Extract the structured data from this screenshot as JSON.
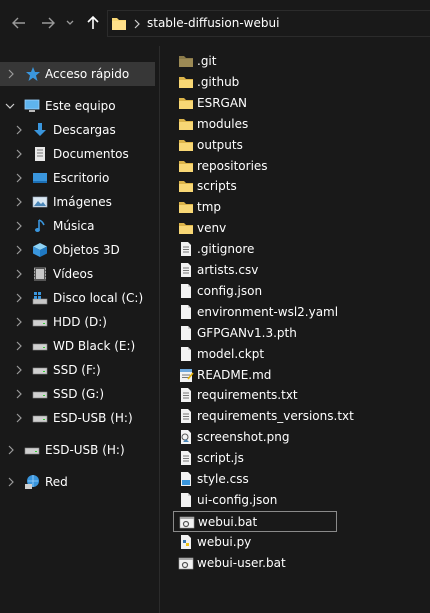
{
  "address": {
    "path": "stable-diffusion-webui"
  },
  "nav": {
    "quick_access": "Acceso rápido",
    "this_pc": "Este equipo",
    "items": [
      {
        "label": "Descargas",
        "icon": "download-arrow-icon"
      },
      {
        "label": "Documentos",
        "icon": "documents-icon"
      },
      {
        "label": "Escritorio",
        "icon": "desktop-icon"
      },
      {
        "label": "Imágenes",
        "icon": "pictures-icon"
      },
      {
        "label": "Música",
        "icon": "music-note-icon"
      },
      {
        "label": "Objetos 3D",
        "icon": "cube-3d-icon"
      },
      {
        "label": "Vídeos",
        "icon": "videos-icon"
      },
      {
        "label": "Disco local (C:)",
        "icon": "windows-drive-icon"
      },
      {
        "label": "HDD (D:)",
        "icon": "drive-icon"
      },
      {
        "label": "WD Black (E:)",
        "icon": "drive-icon"
      },
      {
        "label": "SSD (F:)",
        "icon": "drive-icon"
      },
      {
        "label": "SSD (G:)",
        "icon": "drive-icon"
      },
      {
        "label": "ESD-USB (H:)",
        "icon": "drive-icon"
      }
    ],
    "esd_usb": "ESD-USB (H:)",
    "network": "Red"
  },
  "files": [
    {
      "name": ".git",
      "type": "folder-dim"
    },
    {
      "name": ".github",
      "type": "folder"
    },
    {
      "name": "ESRGAN",
      "type": "folder"
    },
    {
      "name": "modules",
      "type": "folder"
    },
    {
      "name": "outputs",
      "type": "folder"
    },
    {
      "name": "repositories",
      "type": "folder"
    },
    {
      "name": "scripts",
      "type": "folder"
    },
    {
      "name": "tmp",
      "type": "folder"
    },
    {
      "name": "venv",
      "type": "folder"
    },
    {
      "name": ".gitignore",
      "type": "text"
    },
    {
      "name": "artists.csv",
      "type": "text"
    },
    {
      "name": "config.json",
      "type": "blank"
    },
    {
      "name": "environment-wsl2.yaml",
      "type": "blank"
    },
    {
      "name": "GFPGANv1.3.pth",
      "type": "blank"
    },
    {
      "name": "model.ckpt",
      "type": "blank"
    },
    {
      "name": "README.md",
      "type": "notepad"
    },
    {
      "name": "requirements.txt",
      "type": "text"
    },
    {
      "name": "requirements_versions.txt",
      "type": "text"
    },
    {
      "name": "screenshot.png",
      "type": "image"
    },
    {
      "name": "script.js",
      "type": "text"
    },
    {
      "name": "style.css",
      "type": "css"
    },
    {
      "name": "ui-config.json",
      "type": "blank"
    },
    {
      "name": "webui.bat",
      "type": "bat",
      "selected": true
    },
    {
      "name": "webui.py",
      "type": "python"
    },
    {
      "name": "webui-user.bat",
      "type": "bat"
    }
  ],
  "colors": {
    "background": "#191919",
    "folder": "#f8d775",
    "selected_nav": "#373737",
    "accent_blue": "#3a96dd"
  }
}
